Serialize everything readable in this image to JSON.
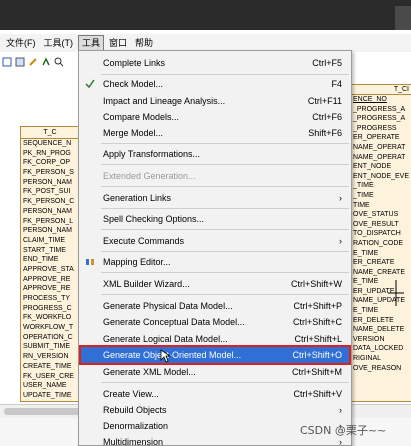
{
  "menubar": {
    "items": [
      "文件(F)",
      "工具(T)",
      "工具",
      "窗口",
      "帮助"
    ]
  },
  "dropdown": {
    "items": [
      {
        "label": "Complete Links",
        "shortcut": "Ctrl+F5"
      },
      {
        "label": "Check Model...",
        "shortcut": "F4"
      },
      {
        "label": "Impact and Lineage Analysis...",
        "shortcut": "Ctrl+F11"
      },
      {
        "label": "Compare Models...",
        "shortcut": "Ctrl+F6"
      },
      {
        "label": "Merge Model...",
        "shortcut": "Shift+F6"
      },
      {
        "label": "Apply Transformations...",
        "shortcut": ""
      },
      {
        "label": "Extended Generation...",
        "shortcut": ""
      },
      {
        "label": "Generation Links",
        "shortcut": ""
      },
      {
        "label": "Spell Checking Options...",
        "shortcut": ""
      },
      {
        "label": "Execute Commands",
        "shortcut": ""
      },
      {
        "label": "Mapping Editor...",
        "shortcut": ""
      },
      {
        "label": "XML Builder Wizard...",
        "shortcut": "Ctrl+Shift+W"
      },
      {
        "label": "Generate Physical Data Model...",
        "shortcut": "Ctrl+Shift+P"
      },
      {
        "label": "Generate Conceptual Data Model...",
        "shortcut": "Ctrl+Shift+C"
      },
      {
        "label": "Generate Logical Data Model...",
        "shortcut": "Ctrl+Shift+L"
      },
      {
        "label": "Generate Object-Oriented Model...",
        "shortcut": "Ctrl+Shift+O"
      },
      {
        "label": "Generate XML Model...",
        "shortcut": "Ctrl+Shift+M"
      },
      {
        "label": "Create View...",
        "shortcut": "Ctrl+Shift+V"
      },
      {
        "label": "Rebuild Objects",
        "shortcut": ""
      },
      {
        "label": "Denormalization",
        "shortcut": ""
      },
      {
        "label": "Multidimension",
        "shortcut": ""
      }
    ]
  },
  "entity_left": {
    "title": "T_C",
    "rows": [
      "SEQUENCE_N",
      "PK_RN_PROG",
      "FK_CORP_OP",
      "FK_PERSON_S",
      "PERSON_NAM",
      "FK_POST_SUI",
      "FK_PERSON_C",
      "PERSON_NAM",
      "FK_PERSON_L",
      "PERSON_NAM",
      "CLAIM_TIME",
      "START_TIME",
      "END_TIME",
      "APPROVE_STA",
      "APPROVE_RE",
      "APPROVE_RE",
      "PROCESS_TY",
      "PROGRESS_C",
      "FK_WORKFLO",
      "WORKFLOW_T",
      "OPERATION_C",
      "SUBMIT_TIME",
      "RN_VERSION",
      "CREATE_TIME",
      "FK_USER_CRE",
      "USER_NAME",
      "UPDATE_TIME"
    ]
  },
  "entity_right": {
    "title": "T_CI",
    "rows": [
      "ENCE_NO",
      "_PROGRESS_A",
      "_PROGRESS_A",
      "_PROGRESS",
      "ER_OPERATE",
      "NAME_OPERAT",
      "NAME_OPERAT",
      "ENT_NODE",
      "ENT_NODE_EVE",
      "_TIME",
      "_TIME",
      "TIME",
      "OVE_STATUS",
      "OVE_RESULT",
      "TO_DISPATCH",
      "RATION_CODE",
      "E_TIME",
      "ER_CREATE",
      "NAME_CREATE",
      "E_TIME",
      "ER_UPDATE",
      "NAME_UPDATE",
      "E_TIME",
      "ER_DELETE",
      "NAME_DELETE",
      "VERSION",
      "DATA_LOCKED",
      "RIGINAL",
      "OVE_REASON"
    ]
  },
  "watermark": "CSDN @栗子~~"
}
